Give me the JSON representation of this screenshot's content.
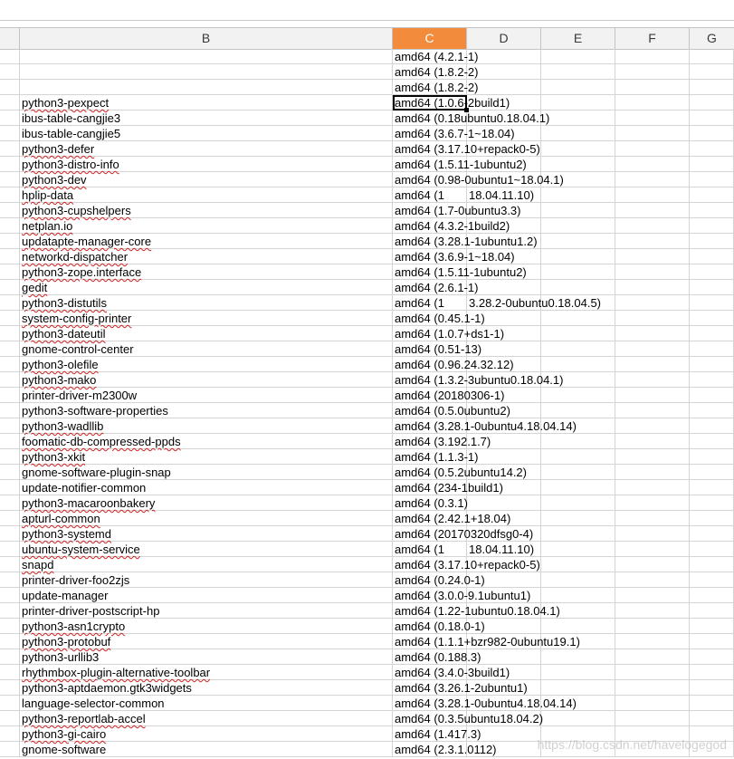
{
  "columns": [
    "B",
    "C",
    "D",
    "E",
    "F",
    "G"
  ],
  "active_column": "C",
  "selected_row_index": 3,
  "rows": [
    {
      "b": "",
      "c": "amd64 (4.2.1-1)",
      "d": ""
    },
    {
      "b": "",
      "c": "amd64 (1.8.2-2)",
      "d": ""
    },
    {
      "b": "",
      "c": "amd64 (1.8.2-2)",
      "d": ""
    },
    {
      "b": "python3-pexpect",
      "c": "amd64 (1.0.6-2build1)",
      "d": ""
    },
    {
      "b": "ibus-table-cangjie3",
      "c": "amd64 (0.18ubuntu0.18.04.1)",
      "d": ""
    },
    {
      "b": "ibus-table-cangjie5",
      "c": "amd64 (3.6.7-1~18.04)",
      "d": ""
    },
    {
      "b": "python3-defer",
      "c": "amd64 (3.17.10+repack0-5)",
      "d": ""
    },
    {
      "b": "python3-distro-info",
      "c": "amd64 (1.5.11-1ubuntu2)",
      "d": ""
    },
    {
      "b": "python3-dev",
      "c": "amd64 (0.98-0ubuntu1~18.04.1)",
      "d": ""
    },
    {
      "b": "hplip-data",
      "c": "amd64 (1",
      "d": "18.04.11.10)"
    },
    {
      "b": "python3-cupshelpers",
      "c": "amd64 (1.7-0ubuntu3.3)",
      "d": ""
    },
    {
      "b": "netplan.io",
      "c": "amd64 (4.3.2-1build2)",
      "d": ""
    },
    {
      "b": "updatapte-manager-core",
      "c": "amd64 (3.28.1-1ubuntu1.2)",
      "d": ""
    },
    {
      "b": "networkd-dispatcher",
      "c": "amd64 (3.6.9-1~18.04)",
      "d": ""
    },
    {
      "b": "python3-zope.interface",
      "c": "amd64 (1.5.11-1ubuntu2)",
      "d": ""
    },
    {
      "b": "gedit",
      "c": "amd64 (2.6.1-1)",
      "d": ""
    },
    {
      "b": "python3-distutils",
      "c": "amd64 (1",
      "d": "3.28.2-0ubuntu0.18.04.5)"
    },
    {
      "b": "system-config-printer",
      "c": "amd64 (0.45.1-1)",
      "d": ""
    },
    {
      "b": "python3-dateutil",
      "c": "amd64 (1.0.7+ds1-1)",
      "d": ""
    },
    {
      "b": "gnome-control-center",
      "c": "amd64 (0.51-13)",
      "d": ""
    },
    {
      "b": "python3-olefile",
      "c": "amd64 (0.96.24.32.12)",
      "d": ""
    },
    {
      "b": "python3-mako",
      "c": "amd64 (1.3.2-3ubuntu0.18.04.1)",
      "d": ""
    },
    {
      "b": "printer-driver-m2300w",
      "c": "amd64 (20180306-1)",
      "d": ""
    },
    {
      "b": "python3-software-properties",
      "c": "amd64 (0.5.0ubuntu2)",
      "d": ""
    },
    {
      "b": "python3-wadllib",
      "c": "amd64 (3.28.1-0ubuntu4.18.04.14)",
      "d": ""
    },
    {
      "b": "foomatic-db-compressed-ppds",
      "c": "amd64 (3.192.1.7)",
      "d": ""
    },
    {
      "b": "python3-xkit",
      "c": "amd64 (1.1.3-1)",
      "d": ""
    },
    {
      "b": "gnome-software-plugin-snap",
      "c": "amd64 (0.5.2ubuntu14.2)",
      "d": ""
    },
    {
      "b": "update-notifier-common",
      "c": "amd64 (234-1build1)",
      "d": ""
    },
    {
      "b": "python3-macaroonbakery",
      "c": "amd64 (0.3.1)",
      "d": ""
    },
    {
      "b": "apturl-common",
      "c": "amd64 (2.42.1+18.04)",
      "d": ""
    },
    {
      "b": "python3-systemd",
      "c": "amd64 (20170320dfsg0-4)",
      "d": ""
    },
    {
      "b": "ubuntu-system-service",
      "c": "amd64 (1",
      "d": "18.04.11.10)"
    },
    {
      "b": "snapd",
      "c": "amd64 (3.17.10+repack0-5)",
      "d": ""
    },
    {
      "b": "printer-driver-foo2zjs",
      "c": "amd64 (0.24.0-1)",
      "d": ""
    },
    {
      "b": "update-manager",
      "c": "amd64 (3.0.0-9.1ubuntu1)",
      "d": ""
    },
    {
      "b": "printer-driver-postscript-hp",
      "c": "amd64 (1.22-1ubuntu0.18.04.1)",
      "d": ""
    },
    {
      "b": "python3-asn1crypto",
      "c": "amd64 (0.18.0-1)",
      "d": ""
    },
    {
      "b": "python3-protobuf",
      "c": "amd64 (1.1.1+bzr982-0ubuntu19.1)",
      "d": ""
    },
    {
      "b": "python3-urllib3",
      "c": "amd64 (0.188.3)",
      "d": ""
    },
    {
      "b": "rhythmbox-plugin-alternative-toolbar",
      "c": "amd64 (3.4.0-3build1)",
      "d": ""
    },
    {
      "b": "python3-aptdaemon.gtk3widgets",
      "c": "amd64 (3.26.1-2ubuntu1)",
      "d": ""
    },
    {
      "b": "language-selector-common",
      "c": "amd64 (3.28.1-0ubuntu4.18.04.14)",
      "d": ""
    },
    {
      "b": "python3-reportlab-accel",
      "c": "amd64 (0.3.5ubuntu18.04.2)",
      "d": ""
    },
    {
      "b": "python3-gi-cairo",
      "c": "amd64 (1.417.3)",
      "d": ""
    },
    {
      "b": "gnome-software",
      "c": "amd64 (2.3.1.0112)",
      "d": ""
    }
  ],
  "spell_flagged": [
    3,
    6,
    7,
    8,
    9,
    10,
    11,
    12,
    13,
    14,
    15,
    16,
    17,
    18,
    20,
    21,
    24,
    25,
    26,
    29,
    30,
    31,
    32,
    33,
    37,
    38,
    40,
    43,
    44
  ],
  "watermark": "https://blog.csdn.net/havelogegod",
  "colors": {
    "active_header": "#f28c3c",
    "gridline": "#d4d4d4",
    "spell_underline": "#d02020"
  }
}
